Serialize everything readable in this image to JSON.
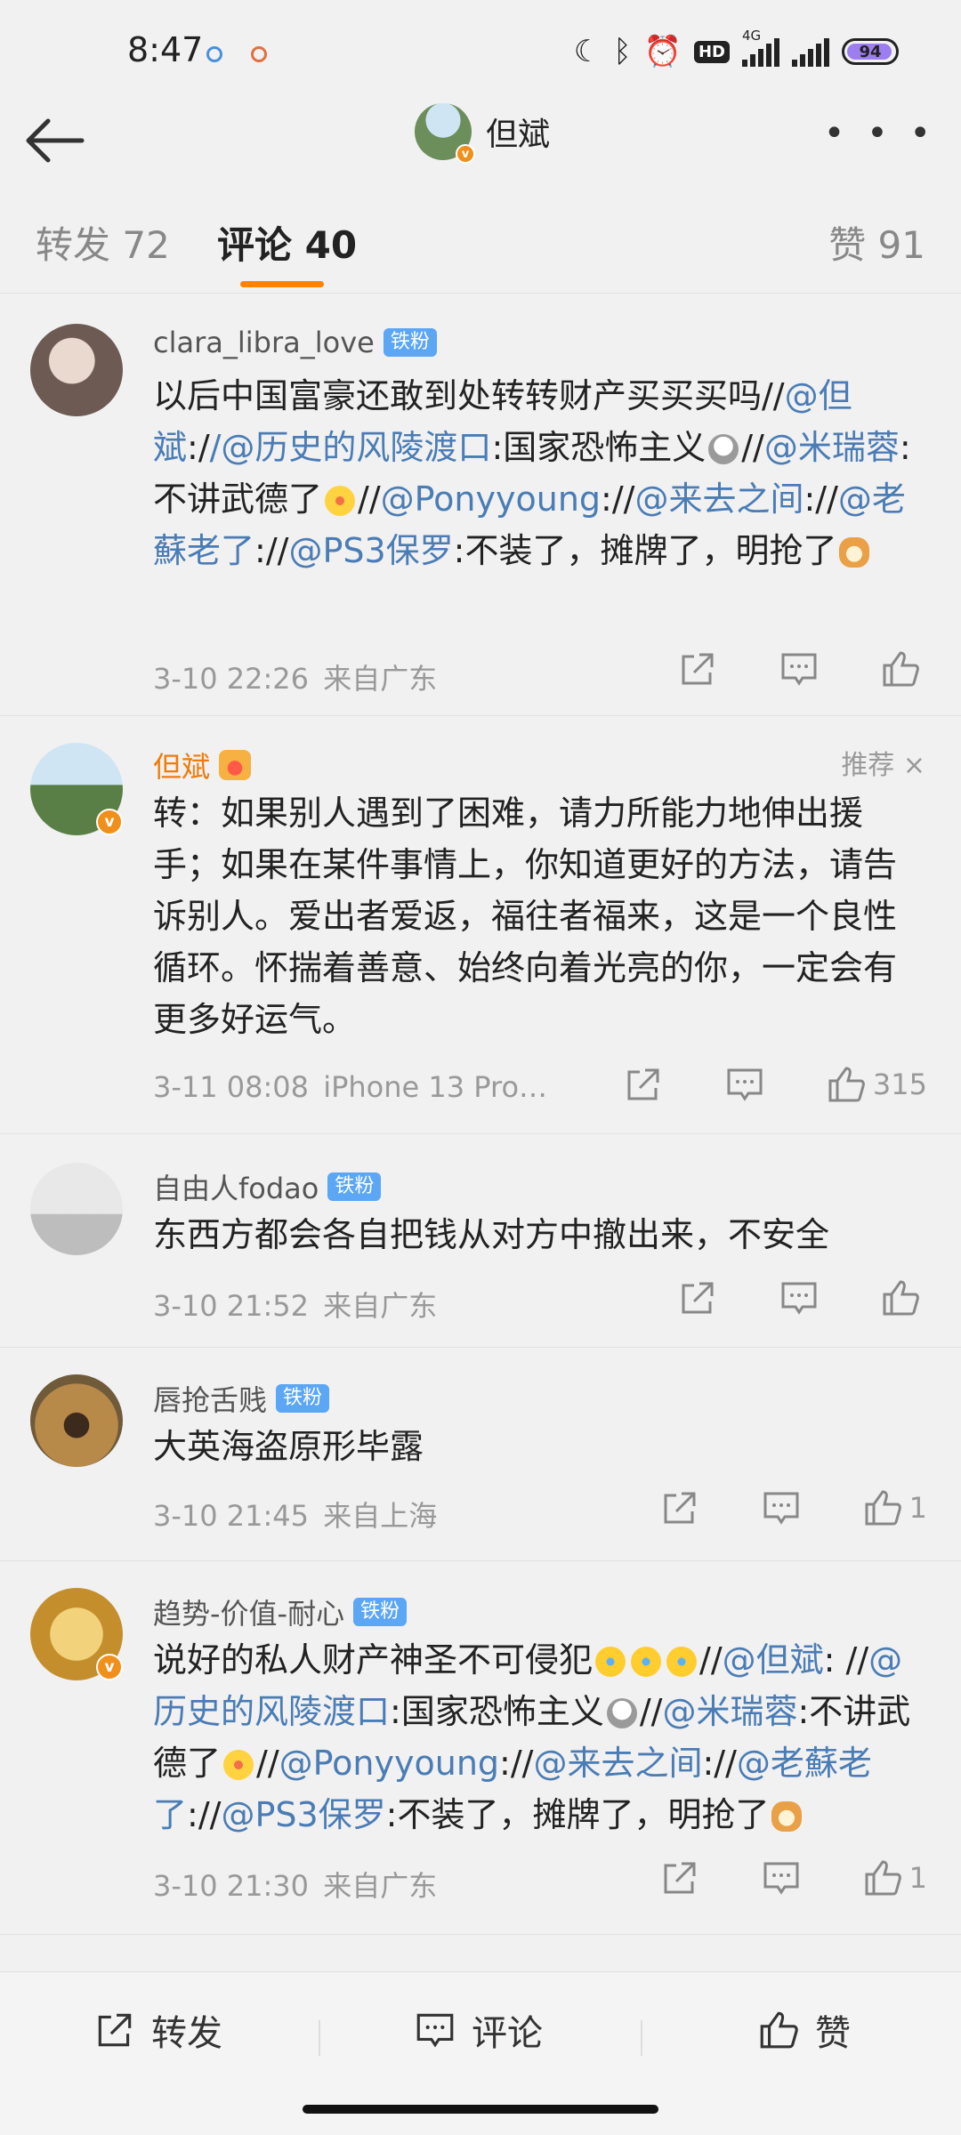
{
  "status_bar": {
    "time": "8:47",
    "network": "4G",
    "battery": "94",
    "hd_label": "HD"
  },
  "header": {
    "title": "但斌"
  },
  "tabs": [
    {
      "label": "转发 72"
    },
    {
      "label": "评论 40"
    },
    {
      "label": "赞 91"
    }
  ],
  "comments": [
    {
      "user": "clara_libra_love",
      "badge": "铁粉",
      "content_parts": [
        {
          "t": "text",
          "v": "以后中国富豪还敢到处转转财产买买买吗//"
        },
        {
          "t": "mention",
          "v": "@但斌"
        },
        {
          "t": "text",
          "v": ":/"
        },
        {
          "t": "mention",
          "v": "/@历史的风陵渡口"
        },
        {
          "t": "text",
          "v": ":国家恐怖主义"
        },
        {
          "t": "emoji",
          "v": "skull"
        },
        {
          "t": "text",
          "v": "//"
        },
        {
          "t": "mention",
          "v": "@米瑞蓉"
        },
        {
          "t": "text",
          "v": ":不讲武德了"
        },
        {
          "t": "emoji",
          "v": "dizzy"
        },
        {
          "t": "text",
          "v": "//"
        },
        {
          "t": "mention",
          "v": "@Ponyyoung"
        },
        {
          "t": "text",
          "v": "://"
        },
        {
          "t": "mention",
          "v": "@来去之间"
        },
        {
          "t": "text",
          "v": "://"
        },
        {
          "t": "mention",
          "v": "@老蘇老了"
        },
        {
          "t": "text",
          "v": "://"
        },
        {
          "t": "mention",
          "v": "@PS3保罗"
        },
        {
          "t": "text",
          "v": ":不装了，摊牌了，明抢了"
        },
        {
          "t": "emoji",
          "v": "doge"
        }
      ],
      "time": "3-10 22:26",
      "source": "来自广东",
      "likes": ""
    },
    {
      "user": "但斌",
      "badge": "",
      "recommend": "推荐 ×",
      "content_parts": [
        {
          "t": "text",
          "v": "转：如果别人遇到了困难，请力所能力地伸出援手；如果在某件事情上，你知道更好的方法，请告诉别人。爱出者爱返，福往者福来，这是一个良性循环。怀揣着善意、始终向着光亮的你，一定会有更多好运气。"
        }
      ],
      "time": "3-11 08:08",
      "source": "iPhone 13 Pro…",
      "likes": "315"
    },
    {
      "user": "自由人fodao",
      "badge": "铁粉",
      "content_parts": [
        {
          "t": "text",
          "v": "东西方都会各自把钱从对方中撤出来，不安全"
        }
      ],
      "time": "3-10 21:52",
      "source": "来自广东",
      "likes": ""
    },
    {
      "user": "唇抢舌贱",
      "badge": "铁粉",
      "content_parts": [
        {
          "t": "text",
          "v": "大英海盗原形毕露"
        }
      ],
      "time": "3-10 21:45",
      "source": "来自上海",
      "likes": "1"
    },
    {
      "user": "趋势-价值-耐心",
      "badge": "铁粉",
      "content_parts": [
        {
          "t": "text",
          "v": "说好的私人财产神圣不可侵犯"
        },
        {
          "t": "emoji",
          "v": "laugh"
        },
        {
          "t": "emoji",
          "v": "laugh"
        },
        {
          "t": "emoji",
          "v": "laugh"
        },
        {
          "t": "text",
          "v": "//"
        },
        {
          "t": "mention",
          "v": "@但斌"
        },
        {
          "t": "text",
          "v": ": //"
        },
        {
          "t": "mention",
          "v": "@历史的风陵渡口"
        },
        {
          "t": "text",
          "v": ":国家恐怖主义"
        },
        {
          "t": "emoji",
          "v": "skull"
        },
        {
          "t": "text",
          "v": "//"
        },
        {
          "t": "mention",
          "v": "@米瑞蓉"
        },
        {
          "t": "text",
          "v": ":不讲武德了"
        },
        {
          "t": "emoji",
          "v": "dizzy"
        },
        {
          "t": "text",
          "v": "//"
        },
        {
          "t": "mention",
          "v": "@Ponyyoung"
        },
        {
          "t": "text",
          "v": "://"
        },
        {
          "t": "mention",
          "v": "@来去之间"
        },
        {
          "t": "text",
          "v": "://"
        },
        {
          "t": "mention",
          "v": "@老蘇老了"
        },
        {
          "t": "text",
          "v": "://"
        },
        {
          "t": "mention",
          "v": "@PS3保罗"
        },
        {
          "t": "text",
          "v": ":不装了，摊牌了，明抢了"
        },
        {
          "t": "emoji",
          "v": "doge"
        }
      ],
      "time": "3-10 21:30",
      "source": "来自广东",
      "likes": "1"
    }
  ],
  "bottom_bar": {
    "repost": "转发",
    "comment": "评论",
    "like": "赞"
  },
  "colors": {
    "accent": "#ff8200",
    "mention": "#4a7cb5",
    "badge": "#5ba6f5",
    "vip_name": "#f07b0a"
  }
}
